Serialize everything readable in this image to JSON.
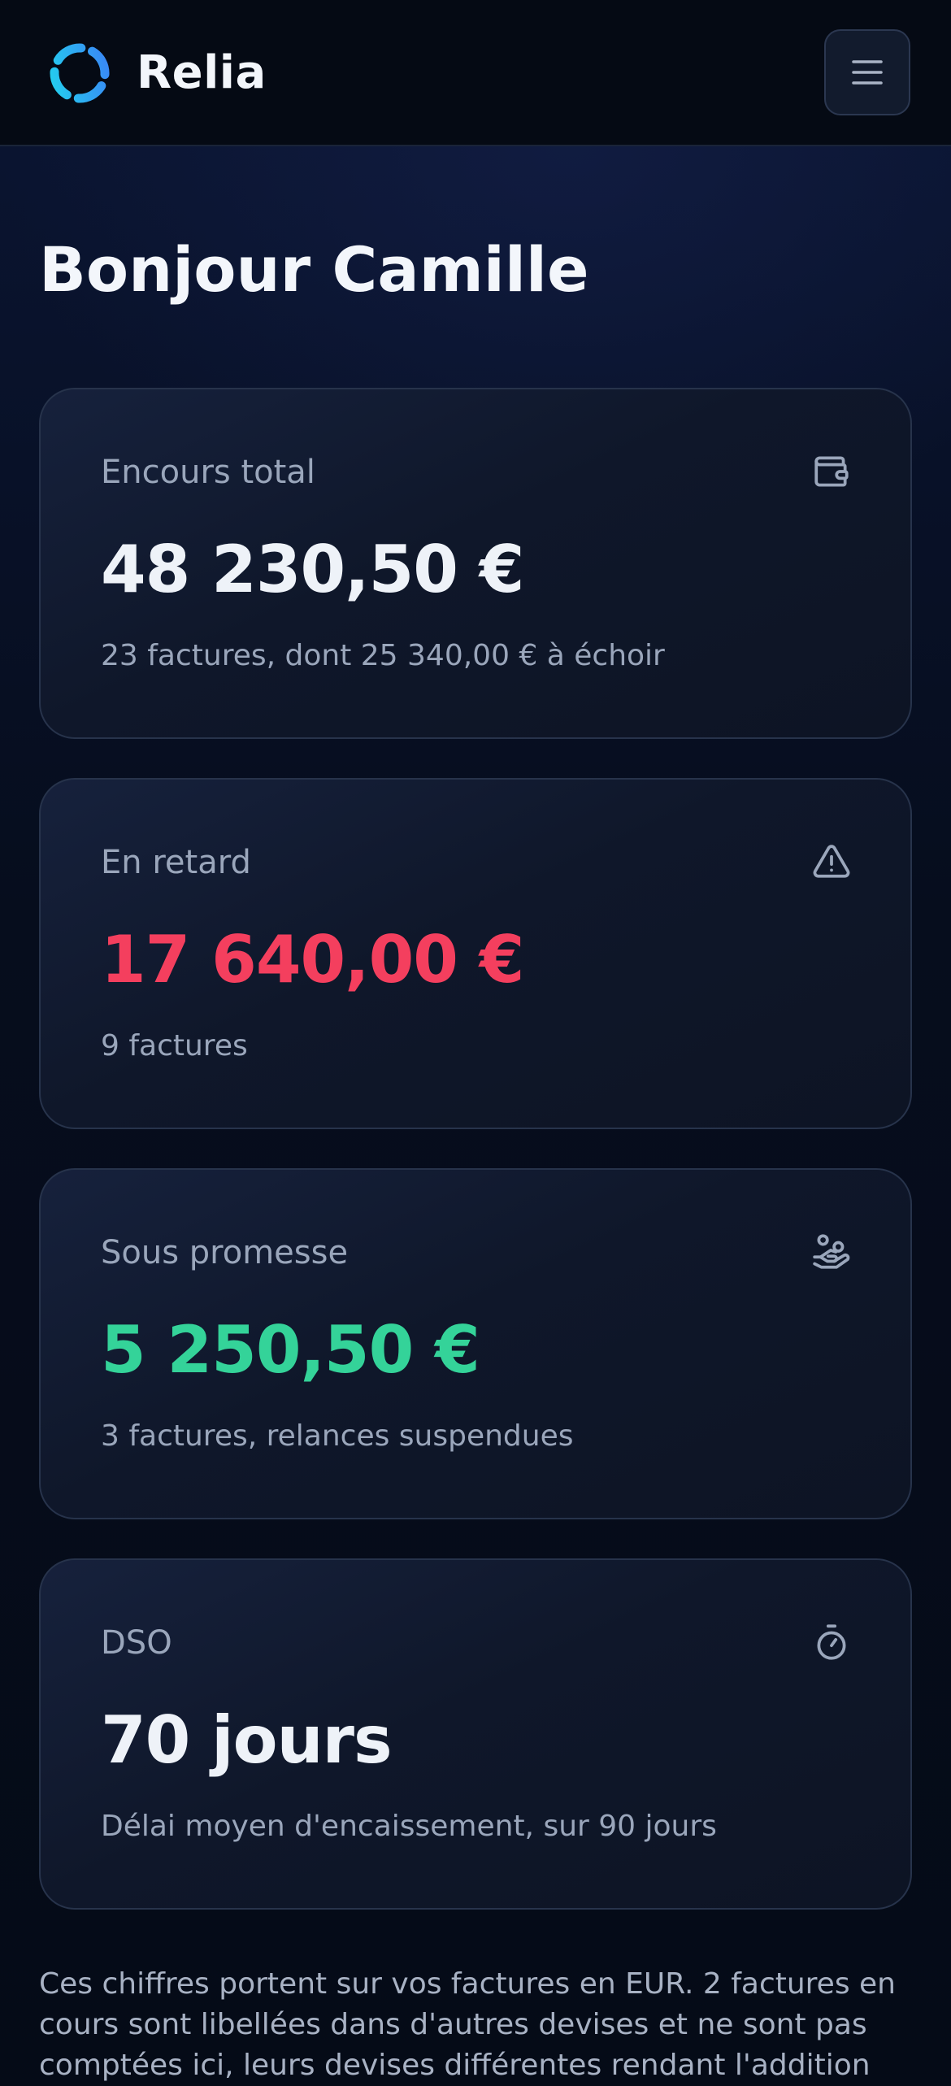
{
  "app": {
    "brand_name": "Relia"
  },
  "header": {
    "menu_icon": "hamburger-menu-icon"
  },
  "greeting": "Bonjour Camille",
  "colors": {
    "accent_cyan": "#22d3ee",
    "accent_blue": "#3b82f6",
    "overdue_red": "#f43f5e",
    "promise_green": "#34d399",
    "neutral_value": "#eef2f8",
    "muted_text": "#9aa6bb"
  },
  "cards": [
    {
      "id": "total",
      "label": "Encours total",
      "value": "48 230,50 €",
      "subtitle": "23 factures, dont 25 340,00 € à échoir",
      "icon": "wallet-icon"
    },
    {
      "id": "overdue",
      "label": "En retard",
      "value": "17 640,00 €",
      "subtitle": "9 factures",
      "icon": "warning-triangle-icon"
    },
    {
      "id": "promise",
      "label": "Sous promesse",
      "value": "5 250,50 €",
      "subtitle": "3 factures, relances suspendues",
      "icon": "hand-coins-icon"
    },
    {
      "id": "dso",
      "label": "DSO",
      "value": "70 jours",
      "subtitle": "Délai moyen d'encaissement, sur 90 jours",
      "icon": "stopwatch-icon"
    }
  ],
  "footnote": "Ces chiffres portent sur vos factures en EUR. 2 factures en cours sont libellées dans d'autres devises et ne sont pas comptées ici, leurs devises différentes rendant l'addition"
}
